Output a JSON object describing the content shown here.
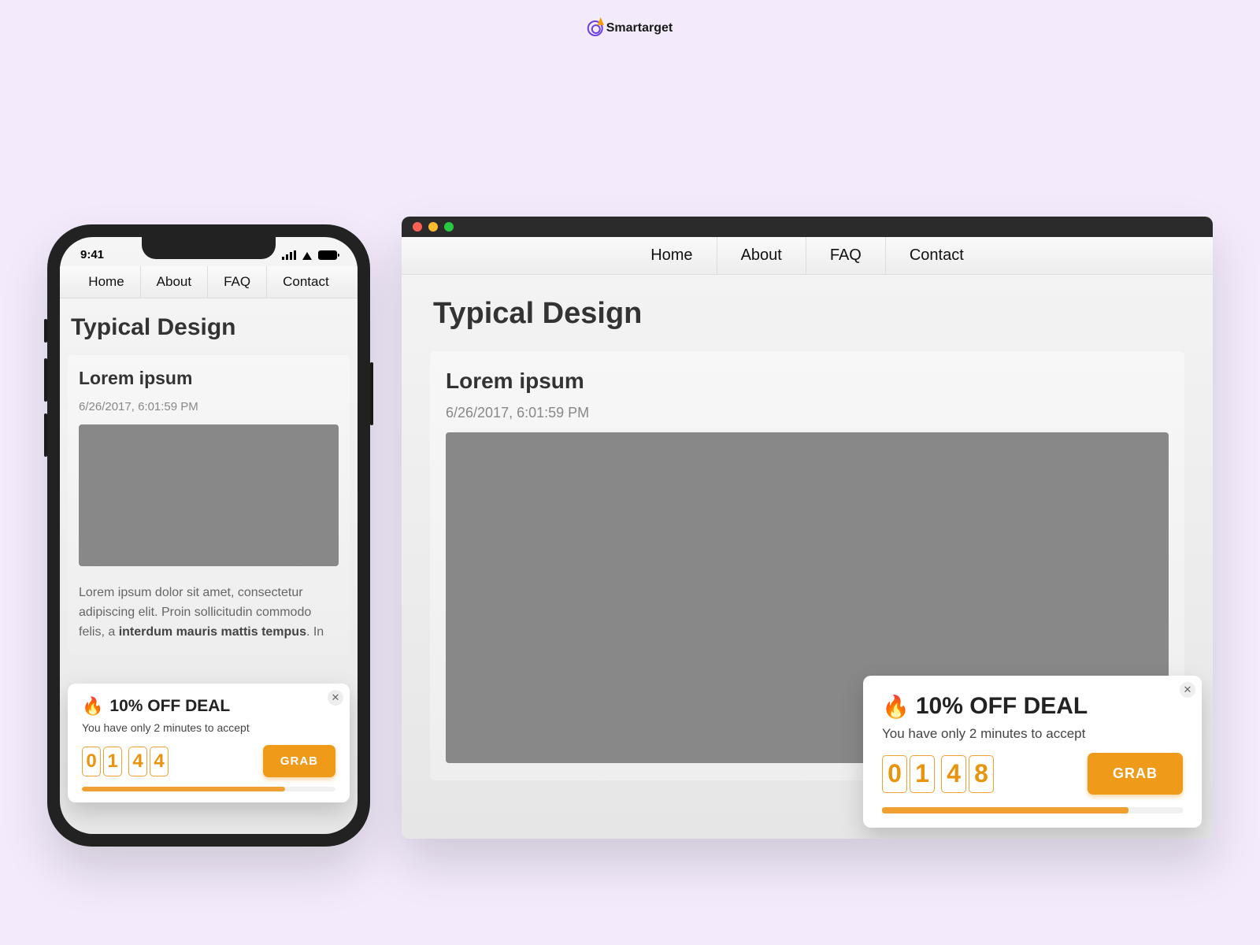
{
  "brand": {
    "name": "Smartarget"
  },
  "nav": {
    "items": [
      "Home",
      "About",
      "FAQ",
      "Contact"
    ]
  },
  "page": {
    "title": "Typical Design"
  },
  "article": {
    "heading": "Lorem ipsum",
    "date": "6/26/2017, 6:01:59 PM",
    "body_pre": "Lorem ipsum dolor sit amet, consectetur adipiscing elit. Proin sollicitudin commodo felis, a ",
    "body_bold": "interdum mauris mattis tempus",
    "body_post": ". In"
  },
  "phone": {
    "time": "9:41",
    "popup": {
      "title": "10% OFF DEAL",
      "subtitle": "You have only 2 minutes to accept",
      "digits": [
        "0",
        "1",
        "4",
        "4"
      ],
      "cta": "GRAB"
    }
  },
  "browser": {
    "popup": {
      "title": "10% OFF DEAL",
      "subtitle": "You have only 2 minutes to accept",
      "digits": [
        "0",
        "1",
        "4",
        "8"
      ],
      "cta": "GRAB"
    }
  }
}
